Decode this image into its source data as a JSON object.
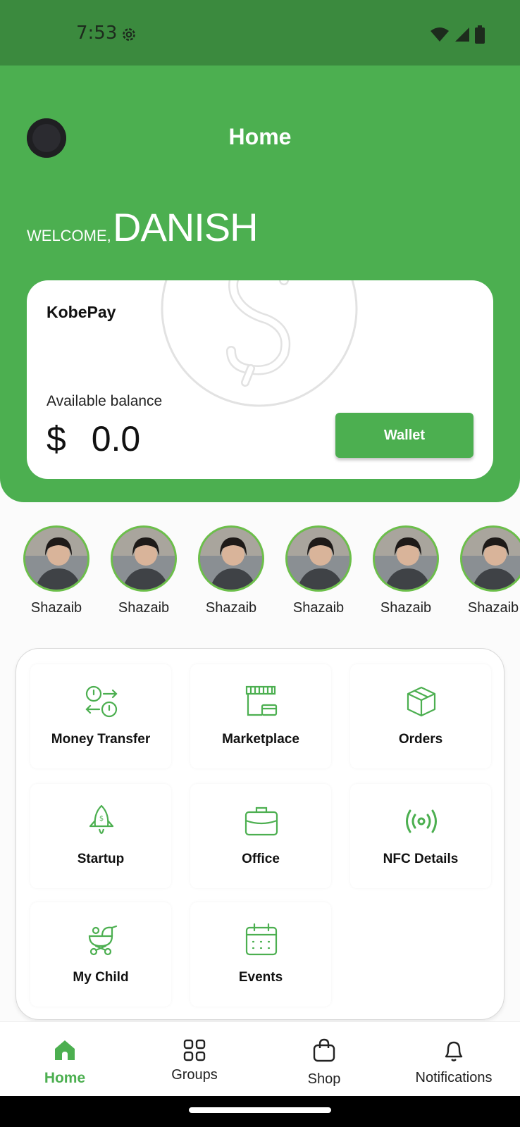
{
  "status": {
    "time": "7:53"
  },
  "header": {
    "title": "Home",
    "welcome": "WELCOME,",
    "username": "DANISH"
  },
  "balance_card": {
    "brand": "KobePay",
    "label": "Available balance",
    "currency": "$",
    "amount": "0.0",
    "wallet_label": "Wallet"
  },
  "stories": [
    {
      "name": "Shazaib"
    },
    {
      "name": "Shazaib"
    },
    {
      "name": "Shazaib"
    },
    {
      "name": "Shazaib"
    },
    {
      "name": "Shazaib"
    },
    {
      "name": "Shazaib"
    }
  ],
  "menu": [
    {
      "label": "Money Transfer",
      "icon": "money-transfer-icon"
    },
    {
      "label": "Marketplace",
      "icon": "store-icon"
    },
    {
      "label": "Orders",
      "icon": "box-icon"
    },
    {
      "label": "Startup",
      "icon": "rocket-icon"
    },
    {
      "label": "Office",
      "icon": "briefcase-icon"
    },
    {
      "label": "NFC Details",
      "icon": "nfc-icon"
    },
    {
      "label": "My Child",
      "icon": "stroller-icon"
    },
    {
      "label": "Events",
      "icon": "calendar-icon"
    }
  ],
  "nav": [
    {
      "label": "Home",
      "icon": "home-icon",
      "active": true
    },
    {
      "label": "Groups",
      "icon": "grid-icon",
      "active": false
    },
    {
      "label": "Shop",
      "icon": "shopping-bag-icon",
      "active": false
    },
    {
      "label": "Notifications",
      "icon": "bell-icon",
      "active": false
    }
  ],
  "colors": {
    "primary": "#4caf50",
    "status_bar": "#3b8a3e"
  }
}
